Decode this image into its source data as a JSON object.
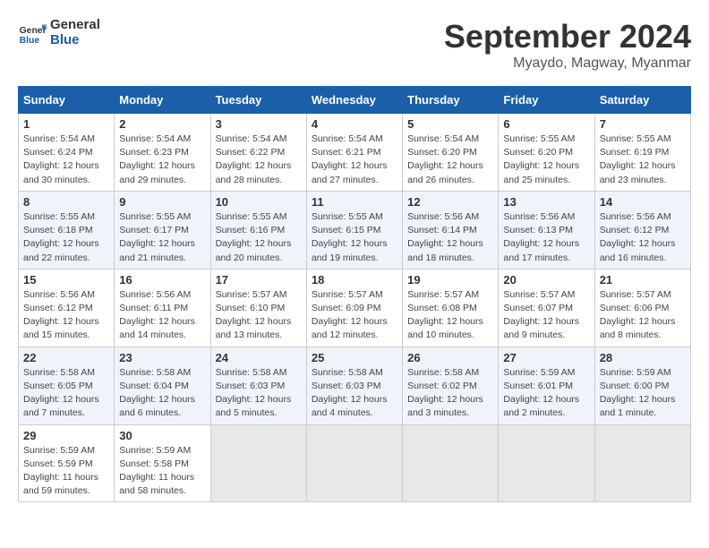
{
  "logo": {
    "line1": "General",
    "line2": "Blue"
  },
  "title": "September 2024",
  "location": "Myaydo, Magway, Myanmar",
  "days_header": [
    "Sunday",
    "Monday",
    "Tuesday",
    "Wednesday",
    "Thursday",
    "Friday",
    "Saturday"
  ],
  "weeks": [
    [
      {
        "num": "1",
        "sunrise": "5:54 AM",
        "sunset": "6:24 PM",
        "daylight": "12 hours and 30 minutes."
      },
      {
        "num": "2",
        "sunrise": "5:54 AM",
        "sunset": "6:23 PM",
        "daylight": "12 hours and 29 minutes."
      },
      {
        "num": "3",
        "sunrise": "5:54 AM",
        "sunset": "6:22 PM",
        "daylight": "12 hours and 28 minutes."
      },
      {
        "num": "4",
        "sunrise": "5:54 AM",
        "sunset": "6:21 PM",
        "daylight": "12 hours and 27 minutes."
      },
      {
        "num": "5",
        "sunrise": "5:54 AM",
        "sunset": "6:20 PM",
        "daylight": "12 hours and 26 minutes."
      },
      {
        "num": "6",
        "sunrise": "5:55 AM",
        "sunset": "6:20 PM",
        "daylight": "12 hours and 25 minutes."
      },
      {
        "num": "7",
        "sunrise": "5:55 AM",
        "sunset": "6:19 PM",
        "daylight": "12 hours and 23 minutes."
      }
    ],
    [
      {
        "num": "8",
        "sunrise": "5:55 AM",
        "sunset": "6:18 PM",
        "daylight": "12 hours and 22 minutes."
      },
      {
        "num": "9",
        "sunrise": "5:55 AM",
        "sunset": "6:17 PM",
        "daylight": "12 hours and 21 minutes."
      },
      {
        "num": "10",
        "sunrise": "5:55 AM",
        "sunset": "6:16 PM",
        "daylight": "12 hours and 20 minutes."
      },
      {
        "num": "11",
        "sunrise": "5:55 AM",
        "sunset": "6:15 PM",
        "daylight": "12 hours and 19 minutes."
      },
      {
        "num": "12",
        "sunrise": "5:56 AM",
        "sunset": "6:14 PM",
        "daylight": "12 hours and 18 minutes."
      },
      {
        "num": "13",
        "sunrise": "5:56 AM",
        "sunset": "6:13 PM",
        "daylight": "12 hours and 17 minutes."
      },
      {
        "num": "14",
        "sunrise": "5:56 AM",
        "sunset": "6:12 PM",
        "daylight": "12 hours and 16 minutes."
      }
    ],
    [
      {
        "num": "15",
        "sunrise": "5:56 AM",
        "sunset": "6:12 PM",
        "daylight": "12 hours and 15 minutes."
      },
      {
        "num": "16",
        "sunrise": "5:56 AM",
        "sunset": "6:11 PM",
        "daylight": "12 hours and 14 minutes."
      },
      {
        "num": "17",
        "sunrise": "5:57 AM",
        "sunset": "6:10 PM",
        "daylight": "12 hours and 13 minutes."
      },
      {
        "num": "18",
        "sunrise": "5:57 AM",
        "sunset": "6:09 PM",
        "daylight": "12 hours and 12 minutes."
      },
      {
        "num": "19",
        "sunrise": "5:57 AM",
        "sunset": "6:08 PM",
        "daylight": "12 hours and 10 minutes."
      },
      {
        "num": "20",
        "sunrise": "5:57 AM",
        "sunset": "6:07 PM",
        "daylight": "12 hours and 9 minutes."
      },
      {
        "num": "21",
        "sunrise": "5:57 AM",
        "sunset": "6:06 PM",
        "daylight": "12 hours and 8 minutes."
      }
    ],
    [
      {
        "num": "22",
        "sunrise": "5:58 AM",
        "sunset": "6:05 PM",
        "daylight": "12 hours and 7 minutes."
      },
      {
        "num": "23",
        "sunrise": "5:58 AM",
        "sunset": "6:04 PM",
        "daylight": "12 hours and 6 minutes."
      },
      {
        "num": "24",
        "sunrise": "5:58 AM",
        "sunset": "6:03 PM",
        "daylight": "12 hours and 5 minutes."
      },
      {
        "num": "25",
        "sunrise": "5:58 AM",
        "sunset": "6:03 PM",
        "daylight": "12 hours and 4 minutes."
      },
      {
        "num": "26",
        "sunrise": "5:58 AM",
        "sunset": "6:02 PM",
        "daylight": "12 hours and 3 minutes."
      },
      {
        "num": "27",
        "sunrise": "5:59 AM",
        "sunset": "6:01 PM",
        "daylight": "12 hours and 2 minutes."
      },
      {
        "num": "28",
        "sunrise": "5:59 AM",
        "sunset": "6:00 PM",
        "daylight": "12 hours and 1 minute."
      }
    ],
    [
      {
        "num": "29",
        "sunrise": "5:59 AM",
        "sunset": "5:59 PM",
        "daylight": "11 hours and 59 minutes."
      },
      {
        "num": "30",
        "sunrise": "5:59 AM",
        "sunset": "5:58 PM",
        "daylight": "11 hours and 58 minutes."
      },
      null,
      null,
      null,
      null,
      null
    ]
  ]
}
